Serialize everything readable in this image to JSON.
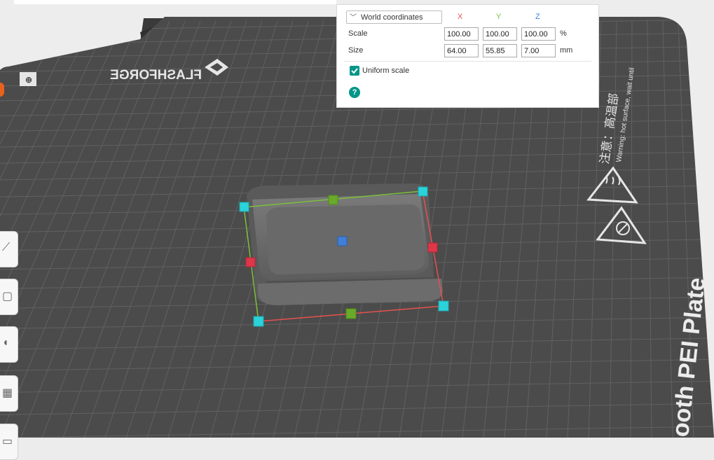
{
  "viewport": {
    "bed": {
      "brand_text": "FLASHFORGE",
      "warning_cn": "注意：高温部",
      "warning_en": "Warning: hot surface, wait until",
      "plate_text": "ooth PEI Plate"
    }
  },
  "scale_panel": {
    "coordinate_mode": "World coordinates",
    "axes": {
      "x": "X",
      "y": "Y",
      "z": "Z"
    },
    "axis_colors": {
      "x": "#e8504f",
      "y": "#7cc03c",
      "z": "#3f7fd9"
    },
    "scale": {
      "label": "Scale",
      "x": "100.00",
      "y": "100.00",
      "z": "100.00",
      "unit": "%"
    },
    "size": {
      "label": "Size",
      "x": "64.00",
      "y": "55.85",
      "z": "7.00",
      "unit": "mm"
    },
    "uniform_scale": {
      "label": "Uniform scale",
      "checked": true
    },
    "help_label": "?"
  },
  "theme": {
    "accent": "#009688",
    "bed": "#4a4a4a",
    "grid": "#5e5e5e"
  }
}
